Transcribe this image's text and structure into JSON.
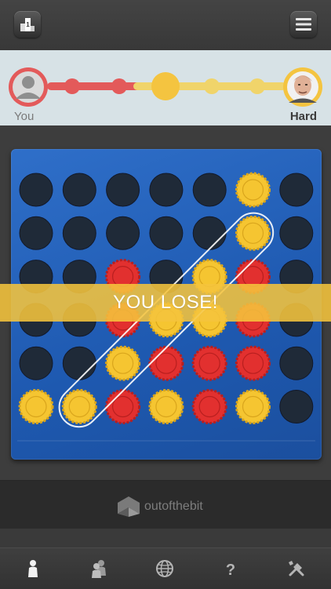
{
  "progress": {
    "left_label": "You",
    "right_label": "Hard",
    "colors": {
      "player": "#e35a5a",
      "opponent": "#f4c440",
      "track": "#f0d46a"
    }
  },
  "board": {
    "rows": 6,
    "cols": 7,
    "grid": [
      [
        "empty",
        "empty",
        "empty",
        "empty",
        "empty",
        "yellow",
        "empty"
      ],
      [
        "empty",
        "empty",
        "empty",
        "empty",
        "empty",
        "yellow",
        "empty"
      ],
      [
        "empty",
        "empty",
        "red",
        "empty",
        "yellow",
        "red",
        "empty"
      ],
      [
        "empty",
        "empty",
        "red",
        "yellow",
        "yellow",
        "red",
        "empty"
      ],
      [
        "empty",
        "empty",
        "yellow",
        "red",
        "red",
        "red",
        "empty"
      ],
      [
        "yellow",
        "yellow",
        "red",
        "yellow",
        "red",
        "yellow",
        "empty"
      ]
    ],
    "colors": {
      "board": "#2463bd",
      "hole": "#1f2a38",
      "red": "#e2302f",
      "yellow": "#f5c531"
    }
  },
  "banner": {
    "text": "YOU LOSE!"
  },
  "ad": {
    "brand": "outofthebit"
  },
  "tabs": [
    {
      "icon": "single-player-icon",
      "active": true
    },
    {
      "icon": "two-player-icon",
      "active": false
    },
    {
      "icon": "globe-icon",
      "active": false
    },
    {
      "icon": "help-icon",
      "active": false
    },
    {
      "icon": "settings-tools-icon",
      "active": false
    }
  ]
}
